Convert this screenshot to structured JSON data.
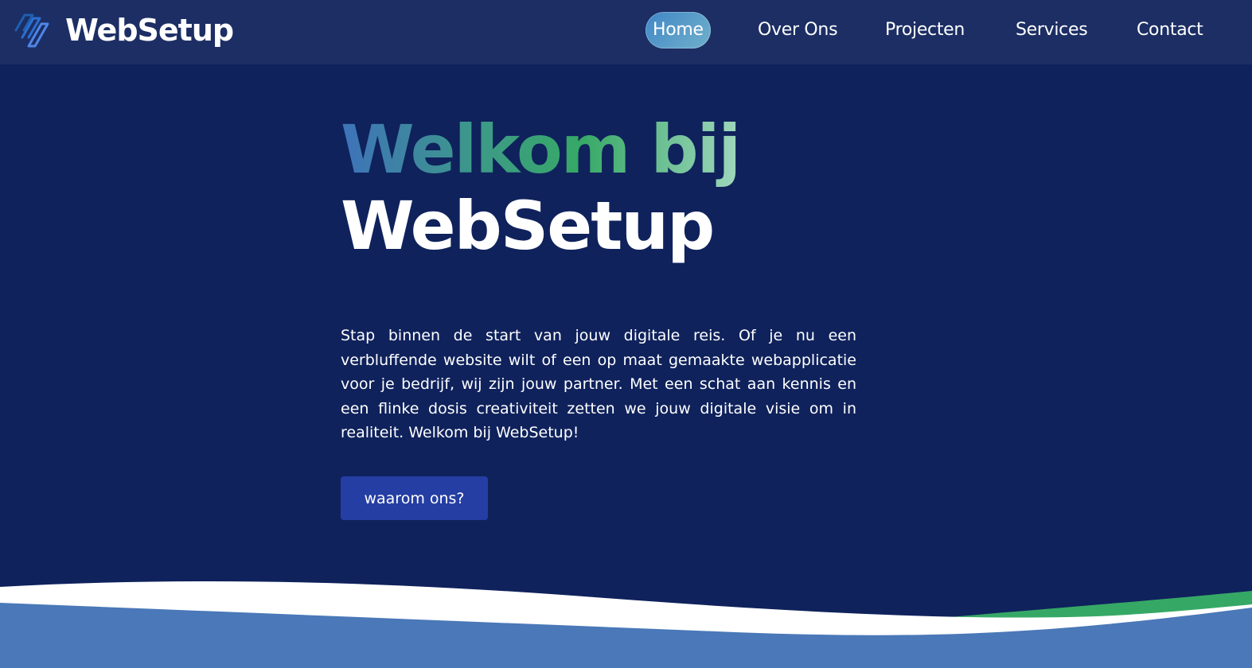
{
  "header": {
    "brand": "WebSetup",
    "logo_icon": "websetup-logo-icon"
  },
  "nav": {
    "items": [
      {
        "label": "Home",
        "active": true
      },
      {
        "label": "Over Ons",
        "active": false
      },
      {
        "label": "Projecten",
        "active": false
      },
      {
        "label": "Services",
        "active": false
      },
      {
        "label": "Contact",
        "active": false
      }
    ]
  },
  "hero": {
    "title_line1": "Welkom bij",
    "title_line2": "WebSetup",
    "paragraph": "Stap binnen de start van jouw digitale reis. Of je nu een verbluffende website wilt of een op maat gemaakte webapplicatie voor je bedrijf, wij zijn jouw partner. Met een schat aan kennis en een flinke dosis creativiteit zetten we jouw digitale visie om in realiteit. Welkom bij WebSetup!",
    "cta_label": "waarom ons?"
  },
  "colors": {
    "background": "#0f225c",
    "navbar": "#1c2e64",
    "active_pill": "#4f95c8",
    "button": "#253ea3",
    "wave_blue": "#4a78b8",
    "wave_green": "#36a866",
    "title_gradient": [
      "#3e72ba",
      "#36a866",
      "#9fd7bd"
    ]
  }
}
